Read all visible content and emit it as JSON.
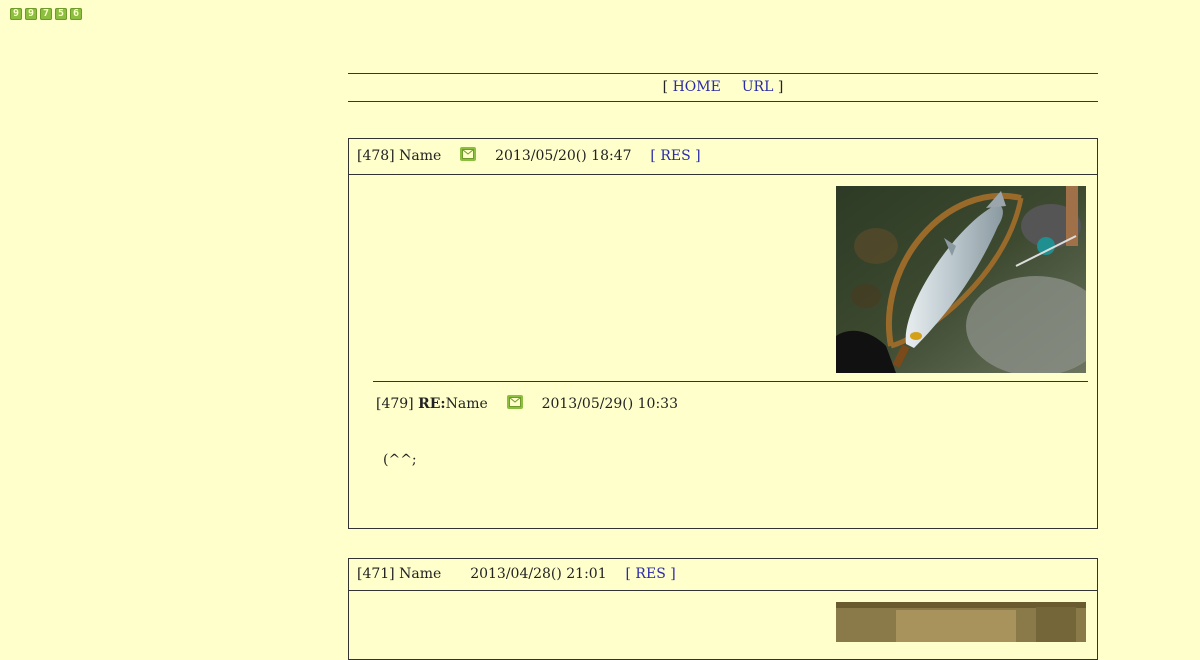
{
  "counter": [
    "9",
    "9",
    "7",
    "5",
    "6"
  ],
  "nav": {
    "open": "[",
    "home": "HOME",
    "url": "URL",
    "close": "]"
  },
  "posts": [
    {
      "number": "[478]",
      "name": "Name",
      "date": "2013/05/20() 18:47",
      "res_label": "[ RES ]",
      "has_mail": true,
      "photo": "fish-in-landing-net",
      "reply": {
        "number": "[479]",
        "prefix": "RE:",
        "name": "Name",
        "date": "2013/05/29() 10:33",
        "text": "(^^;"
      }
    },
    {
      "number": "[471]",
      "name": "Name",
      "date": "2013/04/28() 21:01",
      "res_label": "[ RES ]",
      "has_mail": false,
      "photo": "fish-photo"
    }
  ],
  "colors": {
    "background": "#ffffcc",
    "link": "#2a2aa8",
    "icon": "#8cbf3f"
  }
}
